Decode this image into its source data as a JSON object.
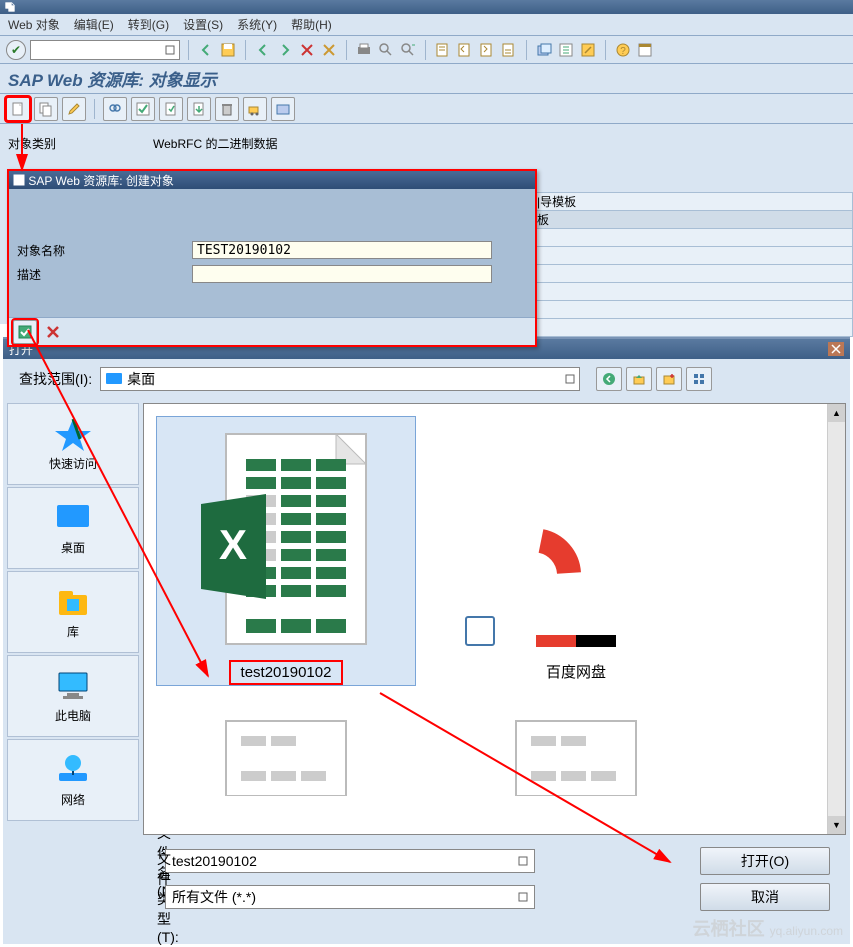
{
  "menubar": {
    "m1": "Web 对象",
    "m2": "编辑(E)",
    "m3": "转到(G)",
    "m4": "设置(S)",
    "m5": "系统(Y)",
    "m6": "帮助(H)"
  },
  "page_title": "SAP Web 资源库: 对象显示",
  "content": {
    "obj_type_label": "对象类别",
    "obj_type_value": "WebRFC 的二进制数据"
  },
  "dialog": {
    "title": "SAP Web 资源库: 创建对象",
    "name_label": "对象名称",
    "name_value": "TEST20190102",
    "desc_label": "描述",
    "desc_value": ""
  },
  "list": {
    "tab": "模板",
    "r1": "|导模板",
    "r2": "板"
  },
  "file_dialog": {
    "title": "打开",
    "lookup_label": "查找范围(I):",
    "lookup_value": "桌面",
    "side": {
      "s1": "快速访问",
      "s2": "桌面",
      "s3": "库",
      "s4": "此电脑",
      "s5": "网络"
    },
    "files": {
      "f1": "test20190102",
      "f2": "百度网盘"
    },
    "filename_label": "文件名(N):",
    "filename_value": "test20190102",
    "filetype_label": "文件类型(T):",
    "filetype_value": "所有文件 (*.*)",
    "open_btn": "打开(O)",
    "cancel_btn": "取消"
  },
  "watermark": {
    "t1": "云栖社区",
    "t2": "yq.aliyun.com"
  }
}
